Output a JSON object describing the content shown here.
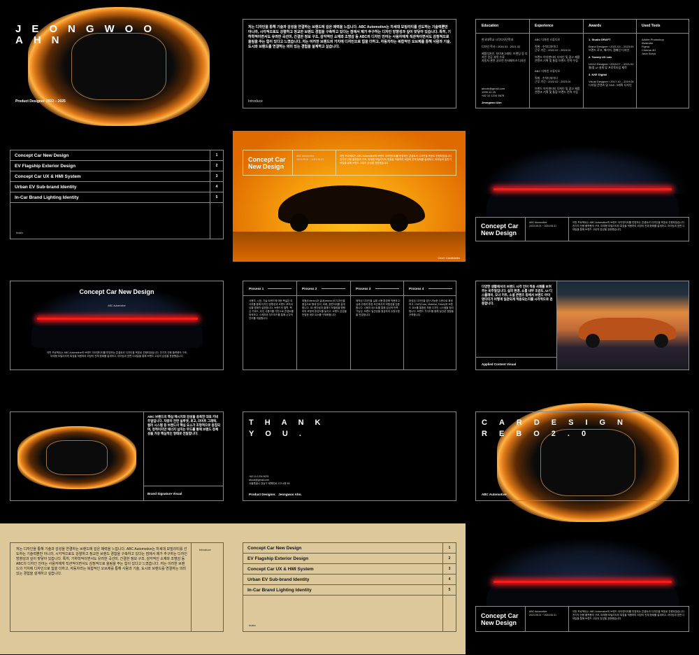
{
  "cover": {
    "title_line1": "JEONGWOO",
    "title_line2": "AHN",
    "role": "Product Designer",
    "years": "2022 – 2025"
  },
  "intro": {
    "text": "저는 디자인을 통해 기술과 감성을 연결하는 브랜드에 깊은 매력을 느낍니다. ABC Automotive는 차세대 모빌리티를 선도하는 기술력뿐만 아니라, 시각적으로도 강렬하고 정교한 브랜드 경험을 구축하고 있다는 점에서 제가 추구하는 디자인 방향성과 깊이 맞닿아 있습니다. 특히, 기하학적이면서도 유려한 곡선미, 간결한 정보 구조, 감각적인 소재와 조명감 등 ABC의 디자인 언어는 사용자에게 직관적이면서도 감정적으로 울림을 주는 힘이 있다고 느꼈습니다. 저는 이러한 브랜드의 가치에 디자인으로 힘을 더하고, 자동차라는 복합적인 오브제를 통해 사람과 기술, 도시와 브랜드를 연결하는 의미 있는 경험을 설계하고 싶습니다.",
    "label": "Introduce"
  },
  "resume": {
    "headers": [
      "Education",
      "Experience",
      "Awards",
      "Used Tools"
    ],
    "education": [
      "한국대학교 시각디자인학과",
      "디자인 학사 / 2016.03 - 2021.02",
      "제품디자인, 타이포그래피, 브랜딩 등 디자인 전공 과목 수료",
      "자동차 관련 공모전 인터페이스 디자인"
    ],
    "contact": [
      "abcde@gmail.com",
      "1999.12.25",
      "+82 10 1234 5678",
      "Jeongwoo Ahn"
    ],
    "experience": [
      "ABC 디자인 스튜디오",
      "직위 : 수석디자이너",
      "근무 기간 : 2022.02 - 2023.01",
      "브랜드 아이덴티티 디자인 및 광고 제품 콘텐츠 기획 및 통합 브랜드 전략 수립",
      "ABC 디자인 스튜디오",
      "직위 : 수석디자이너",
      "근무 기간 : 2022.02 - 2023.01",
      "브랜드 아이덴티티 디자인 및 광고 제품 콘텐츠 기획 및 통합 브랜드 전략 수립"
    ],
    "awards": [
      "1. Studio DRAFT",
      "Brand Designer / 2021.03 – 2023.09",
      "브랜드 로고, 패키지, 캠페인 디자인",
      "2. Twenty UX Lab",
      "UX/UI Designer / 2019.07 – 2021.01",
      "웹/앱 UI 설계 및 프로토타입 제작",
      "3. NXE Digital",
      "Visual Designer / 2017.10 – 2019.04",
      "디지털 콘텐츠 및 SNS 그래픽 디자인"
    ],
    "tools": [
      "Adobe Photoshop",
      "Illustrator",
      "Figma",
      "Cinema 4D",
      "Java Script"
    ]
  },
  "index": {
    "items": [
      "Concept Car New Design",
      "EV Flagship Exterior Design",
      "Concept Car UX & HMI System",
      "Urban EV Sub-brand Identity",
      "In-Car Brand Lighting Identity"
    ],
    "numbers": [
      "1",
      "2",
      "3",
      "4",
      "5"
    ],
    "label": "Index"
  },
  "project": {
    "title": "Concept Car New Design",
    "client": "ABC Automotive",
    "period": "2023.05.01 ~ 2024.06.31",
    "desc": "이번 프로젝트는 ABC Automotive의 브랜드 아이덴티티를 반영하는 콘셉트카 디자인을 목표로 진행되었습니다. 전기차 전용 플랫폼의 구조, 미래형 모빌리티의 특징을 적용하여 외장의 전체 형태를 설계하고, 라이팅과 표면 디테일을 통해 브랜드 고유의 감성을 표현했습니다.",
    "caption": "Circm Candidates"
  },
  "process": [
    {
      "label": "Process 1",
      "text": "사용자, 시장, 기술 트렌드에 대한 폭넓은 리서치를 통해 디자인 방향성과 브랜드 포지셔닝을 명확히 설정합니다. 브랜드의 철학, 핵심 키워드, 타깃 사용자를 기반으로 콘셉트를 정의하고, 스케치와 무드보드를 통해 시각적 언어를 개발합니다."
    },
    {
      "label": "Process 2",
      "text": "외형(Exterior)과 실내(Interior)의 디자인을 중심으로 형태 언어, 비례, 표면처리를 설계합니다. 3D 렌더링과 클레이 모델링을 병행하여 조형의 완성도를 높이고, 브랜드 감성을 반영한 세부 요소를 구체화합니다."
    },
    {
      "label": "Process 3",
      "text": "제작된 디자인을 실제 사용 환경에 적용하고, 실제 주행과 환경 조건에서의 적합성을 검증합니다. 사용자 테스트를 통해 감성적 만족, 기능성, 브랜드 일관성을 점검하여 수정사항을 반영합니다."
    },
    {
      "label": "Process 4",
      "text": "완성된 디자인을 양산 가능한 수준으로 확정하고, CMF(Color, Material, Finish)와 브랜드 요소를 통합한 최종 디자인 시스템을 정리합니다. 브랜드 가이드를 통해 일관된 경험을 구축합니다."
    }
  ],
  "applied": {
    "text": "다양한 생활에서의 브랜드 시각 언어 적용 사례를 보여주는 비주얼입니다. 실외 환경, 쇼룸 내부 조감도, UI 디스플레이, 오너 키트, 소셜 콘텐츠 등에서 브랜드 아이덴티티가 어떻게 일관되게 적용되는지를 시각적으로 검증합니다.",
    "label": "Applied Content Visual"
  },
  "signature": {
    "text": "ABC 브랜드의 핵심 메시지와 감성을 응축한 대표 키비주얼입니다. 차량의 전면 실루엣, 로고, 라이트 그래픽, 컬러 시스템 등 브랜드의 핵심 요소가 조형적으로 응집되며, 정적이지만 에너지 넘치는 무드를 통해 브랜드 정체성을 가장 핵심적인 형태로 전달합니다.",
    "label": "Brand Signature Visual"
  },
  "thanks": {
    "line1": "THANK",
    "line2": "YOU.",
    "contact": [
      "+82 10 1234 5678",
      "abcde@gmail.com",
      "서울특별시 강남구 테헤란로 123 4층 56"
    ],
    "footer": "Product Designer.   Jeongwoo Ahn."
  },
  "cardesign": {
    "line1": "CARDESIGN",
    "line2": "REBO2.0",
    "brand": "ABC Automotive"
  },
  "colors": {
    "beige": "#dcc89b",
    "orange": "#f08a10",
    "tail": "#ff1a1a"
  }
}
